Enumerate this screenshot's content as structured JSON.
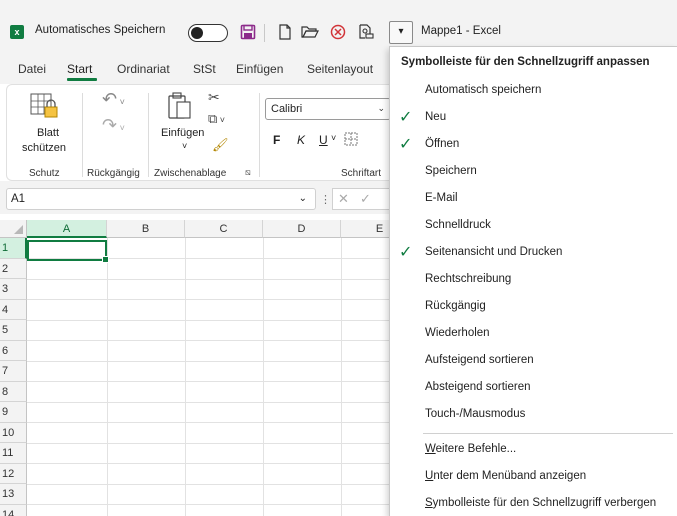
{
  "titlebar": {
    "app_icon": "excel-icon",
    "autosave_label": "Automatisches Speichern",
    "autosave_state": "off",
    "qat_icons": [
      "save-icon",
      "new-file-icon",
      "open-folder-icon",
      "email-icon",
      "print-preview-icon"
    ],
    "qat_dropdown_glyph": "▾",
    "title": "Mappe1 - Excel"
  },
  "tabs": [
    "Datei",
    "Start",
    "Ordinariat",
    "StSt",
    "Einfügen",
    "Seitenlayout"
  ],
  "active_tab": "Start",
  "ribbon": {
    "groups": {
      "schutz": "Schutz",
      "rueckgaengig": "Rückgängig",
      "zwischenablage": "Zwischenablage",
      "schriftart": "Schriftart"
    },
    "blatt_schuetzen_1": "Blatt",
    "blatt_schuetzen_2": "schützen",
    "einfuegen": "Einfügen",
    "font_name": "Calibri",
    "bold": "F",
    "italic": "K",
    "underline": "U"
  },
  "formula_bar": {
    "name_box": "A1",
    "cancel_glyph": "✕",
    "enter_glyph": "✓"
  },
  "grid": {
    "columns": [
      "A",
      "B",
      "C",
      "D",
      "E"
    ],
    "rows": [
      "1",
      "2",
      "3",
      "4",
      "5",
      "6",
      "7",
      "8",
      "9",
      "10",
      "11",
      "12",
      "13",
      "14"
    ],
    "selected_cell": "A1"
  },
  "menu": {
    "title": "Symbolleiste für den Schnellzugriff anpassen",
    "items": [
      {
        "label": "Automatisch speichern",
        "checked": false
      },
      {
        "label": "Neu",
        "checked": true
      },
      {
        "label": "Öffnen",
        "checked": true
      },
      {
        "label": "Speichern",
        "checked": false
      },
      {
        "label": "E-Mail",
        "checked": false
      },
      {
        "label": "Schnelldruck",
        "checked": false
      },
      {
        "label": "Seitenansicht und Drucken",
        "checked": true
      },
      {
        "label": "Rechtschreibung",
        "checked": false
      },
      {
        "label": "Rückgängig",
        "checked": false
      },
      {
        "label": "Wiederholen",
        "checked": false
      },
      {
        "label": "Aufsteigend sortieren",
        "checked": false
      },
      {
        "label": "Absteigend sortieren",
        "checked": false
      },
      {
        "label": "Touch-/Mausmodus",
        "checked": false
      }
    ],
    "extra_items": [
      {
        "first": "W",
        "rest": "eitere Befehle..."
      },
      {
        "first": "U",
        "rest": "nter dem Menüband anzeigen"
      },
      {
        "first": "S",
        "rest": "ymbolleiste für den Schnellzugriff verbergen"
      }
    ]
  },
  "colors": {
    "accent": "#107c41",
    "chrome": "#f3f3f3"
  }
}
